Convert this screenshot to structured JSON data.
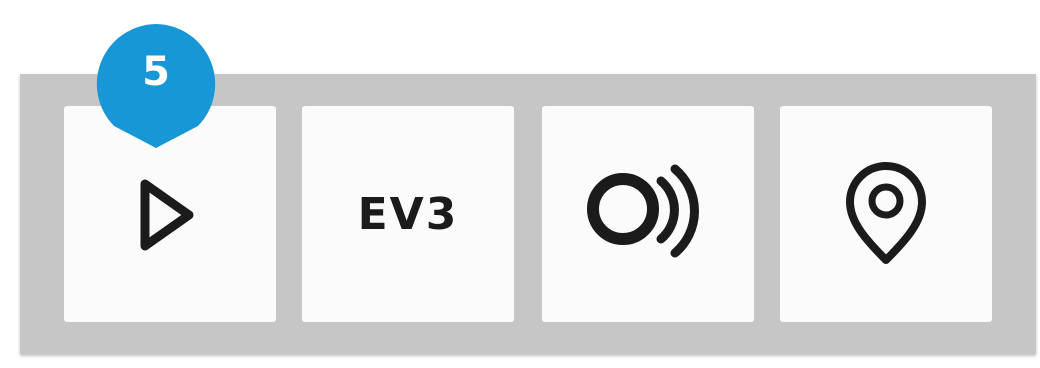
{
  "callout": {
    "number": "5",
    "color": "#1797d6"
  },
  "toolbar": {
    "tiles": [
      {
        "icon": "play-triangle-icon"
      },
      {
        "icon": "ev3-brick-icon",
        "label": "EV3"
      },
      {
        "icon": "sensor-waves-icon"
      },
      {
        "icon": "location-pin-icon"
      }
    ]
  }
}
